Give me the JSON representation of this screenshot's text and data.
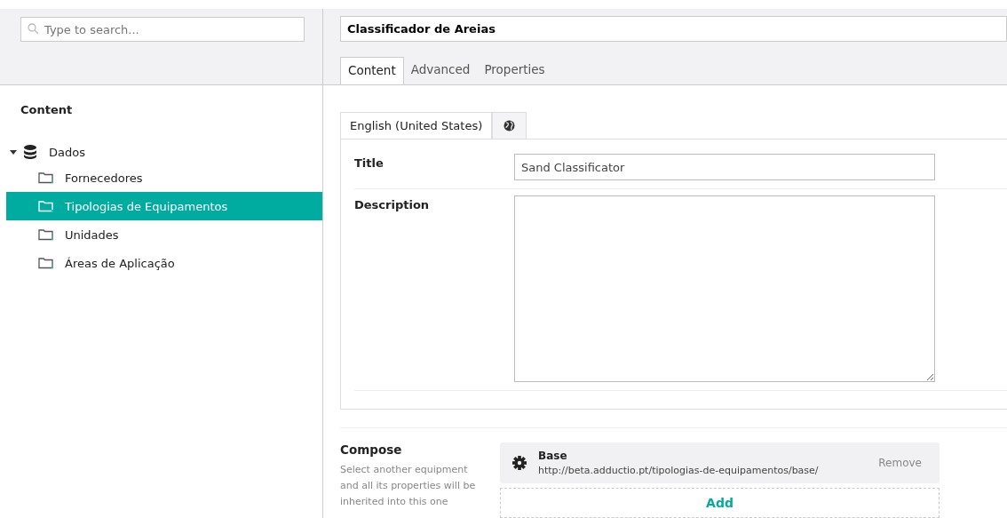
{
  "search": {
    "placeholder": "Type to search..."
  },
  "sidebar": {
    "heading": "Content",
    "tree": [
      {
        "label": "Dados",
        "kind": "database",
        "expanded": true,
        "selected": false,
        "children": [
          {
            "label": "Fornecedores",
            "kind": "folder",
            "selected": false
          },
          {
            "label": "Tipologias de Equipamentos",
            "kind": "folder",
            "selected": true
          },
          {
            "label": "Unidades",
            "kind": "folder",
            "selected": false
          },
          {
            "label": "Áreas de Aplicação",
            "kind": "folder",
            "selected": false
          }
        ]
      }
    ]
  },
  "name_field": {
    "value": "Classificador de Areias"
  },
  "tabs": [
    {
      "label": "Content",
      "selected": true
    },
    {
      "label": "Advanced",
      "selected": false
    },
    {
      "label": "Properties",
      "selected": false
    }
  ],
  "language_tabs": [
    {
      "label": "English (United States)",
      "selected": true
    }
  ],
  "fields": [
    {
      "label": "Title",
      "kind": "text",
      "value": "Sand Classificator"
    },
    {
      "label": "Description",
      "kind": "textarea"
    }
  ],
  "compose": {
    "heading": "Compose",
    "help": "Select another equipment and all its properties will be inherited into this one",
    "items": [
      {
        "name": "Base",
        "url": "http://beta.adductio.pt/tipologias-de-equipamentos/base/",
        "action": "Remove"
      }
    ],
    "add": "Add"
  }
}
